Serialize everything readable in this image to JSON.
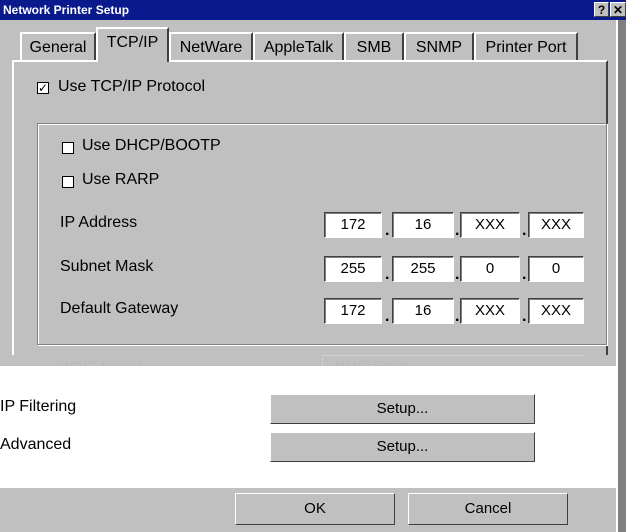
{
  "window": {
    "title": "Network Printer Setup",
    "help_label": "?",
    "close_label": "✕"
  },
  "tabs": [
    {
      "label": "General"
    },
    {
      "label": "TCP/IP"
    },
    {
      "label": "NetWare"
    },
    {
      "label": "AppleTalk"
    },
    {
      "label": "SMB"
    },
    {
      "label": "SNMP"
    },
    {
      "label": "Printer Port"
    }
  ],
  "tcpip": {
    "use_tcpip": {
      "label": "Use TCP/IP Protocol",
      "checked": true,
      "mark": "✓"
    },
    "use_dhcp": {
      "label": "Use DHCP/BOOTP",
      "checked": false
    },
    "use_rarp": {
      "label": "Use RARP",
      "checked": false
    },
    "ip_address": {
      "label": "IP Address",
      "octets": [
        "172",
        "16",
        "XXX",
        "XXX"
      ]
    },
    "subnet_mask": {
      "label": "Subnet Mask",
      "octets": [
        "255",
        "255",
        "0",
        "0"
      ]
    },
    "default_gateway": {
      "label": "Default Gateway",
      "octets": [
        "172",
        "16",
        "XXX",
        "XXX"
      ]
    },
    "separator": "."
  },
  "wins": {
    "label": "WINS Server",
    "value": "WINS Setup"
  },
  "ip_filtering": {
    "label": "IP Filtering",
    "button_label": "Setup..."
  },
  "advanced": {
    "label": "Advanced",
    "button_label": "Setup..."
  },
  "footer": {
    "ok_label": "OK",
    "cancel_label": "Cancel"
  }
}
